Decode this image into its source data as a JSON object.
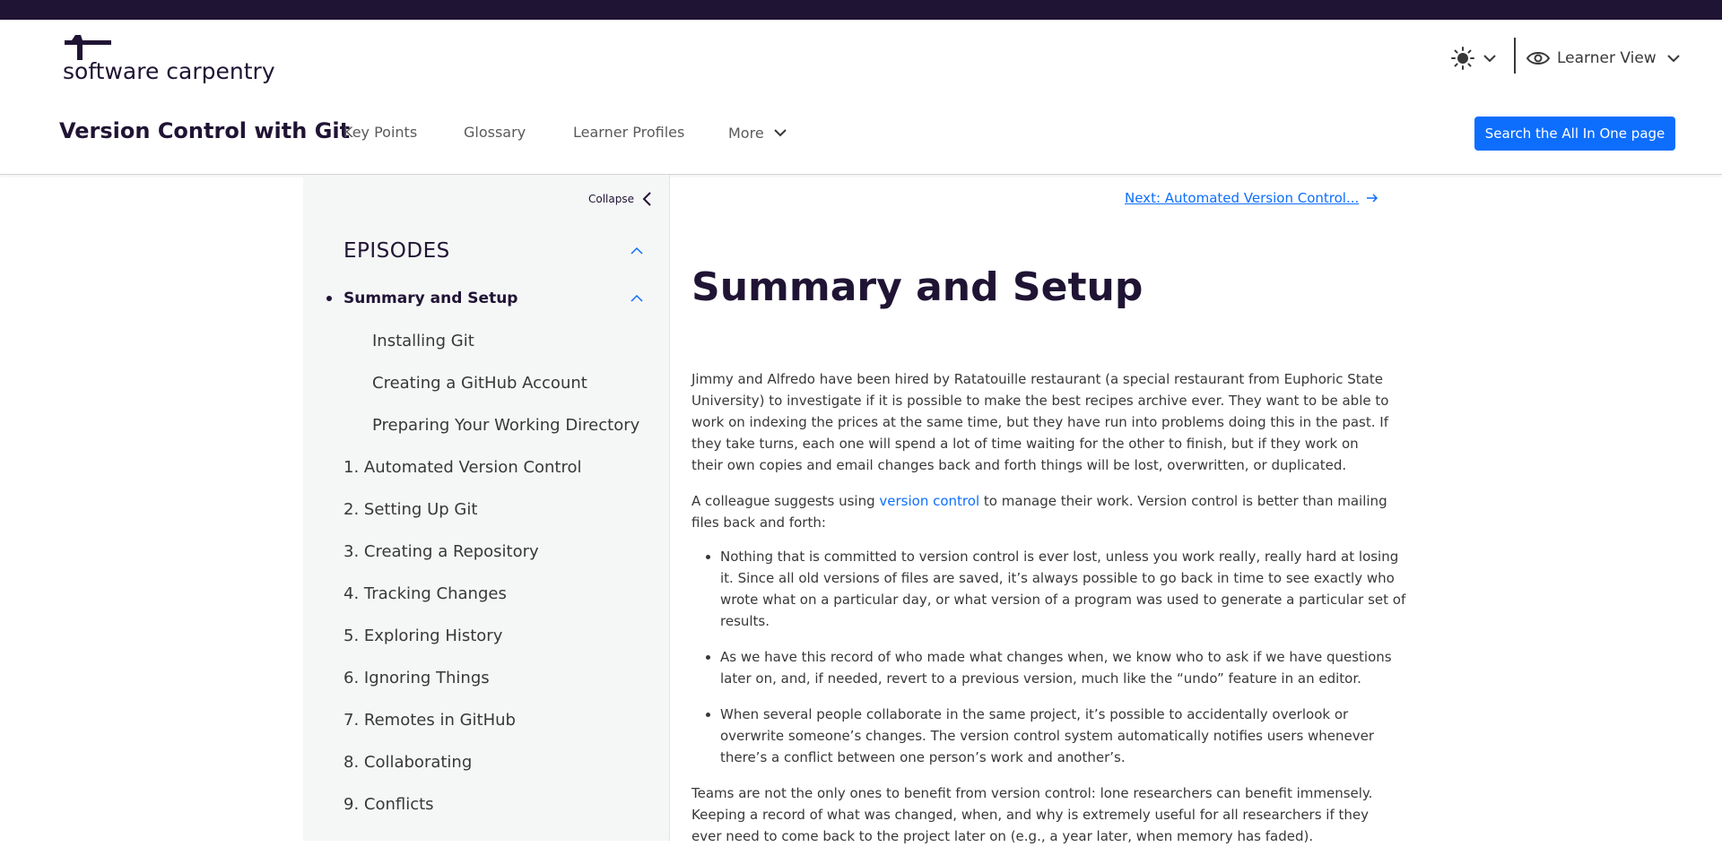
{
  "brand": {
    "logo_text": "software carpentry",
    "colors": {
      "topbar": "#201434",
      "accent": "#0d6efd",
      "text": "#383838",
      "sidebar_bg": "#f5f6f6"
    }
  },
  "header": {
    "theme_icon": "sun-icon",
    "view_label": "Learner View",
    "view_icon": "eye-icon"
  },
  "nav": {
    "site_title": "Version Control with Git",
    "links": [
      "Key Points",
      "Glossary",
      "Learner Profiles"
    ],
    "more_label": "More",
    "search_button": "Search the All In One page"
  },
  "sidebar": {
    "collapse_label": "Collapse",
    "episodes_heading": "EPISODES",
    "current": "Summary and Setup",
    "sub_items": [
      "Installing Git",
      "Creating a GitHub Account",
      "Preparing Your Working Directory"
    ],
    "episodes": [
      "1. Automated Version Control",
      "2. Setting Up Git",
      "3. Creating a Repository",
      "4. Tracking Changes",
      "5. Exploring History",
      "6. Ignoring Things",
      "7. Remotes in GitHub",
      "8. Collaborating",
      "9. Conflicts"
    ]
  },
  "main": {
    "next_link": "Next: Automated Version Control...",
    "title": "Summary and Setup",
    "intro": "Jimmy and Alfredo have been hired by Ratatouille restaurant (a special restaurant from Euphoric State University) to investigate if it is possible to make the best recipes archive ever. They want to be able to work on indexing the prices at the same time, but they have run into problems doing this in the past. If they take turns, each one will spend a lot of time waiting for the other to finish, but if they work on their own copies and email changes back and forth things will be lost, overwritten, or duplicated.",
    "suggest_before": "A colleague suggests using ",
    "suggest_link": "version control",
    "suggest_after": " to manage their work. Version control is better than mailing files back and forth:",
    "bullets": [
      "Nothing that is committed to version control is ever lost, unless you work really, really hard at losing it. Since all old versions of files are saved, it’s always possible to go back in time to see exactly who wrote what on a particular day, or what version of a program was used to generate a particular set of results.",
      "As we have this record of who made what changes when, we know who to ask if we have questions later on, and, if needed, revert to a previous version, much like the “undo” feature in an editor.",
      "When several people collaborate in the same project, it’s possible to accidentally overlook or overwrite someone’s changes. The version control system automatically notifies users whenever there’s a conflict between one person’s work and another’s."
    ],
    "closing": "Teams are not the only ones to benefit from version control: lone researchers can benefit immensely. Keeping a record of what was changed, when, and why is extremely useful for all researchers if they ever need to come back to the project later on (e.g., a year later, when memory has faded)."
  }
}
